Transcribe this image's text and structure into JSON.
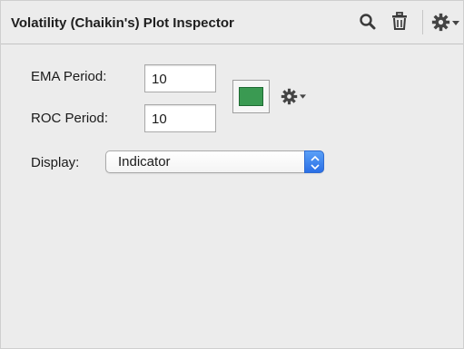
{
  "header": {
    "title": "Volatility (Chaikin's) Plot Inspector",
    "icons": [
      "search-icon",
      "trash-icon",
      "gear-icon",
      "chevron-down-icon"
    ]
  },
  "fields": {
    "ema_label": "EMA Period:",
    "ema_value": "10",
    "roc_label": "ROC Period:",
    "roc_value": "10"
  },
  "color": {
    "swatch": "#3a9a52",
    "action_icon": "gear-icon"
  },
  "display": {
    "label": "Display:",
    "value": "Indicator"
  },
  "colors": {
    "panel_bg": "#ececec",
    "accent_stepper": "#3b82f0"
  }
}
